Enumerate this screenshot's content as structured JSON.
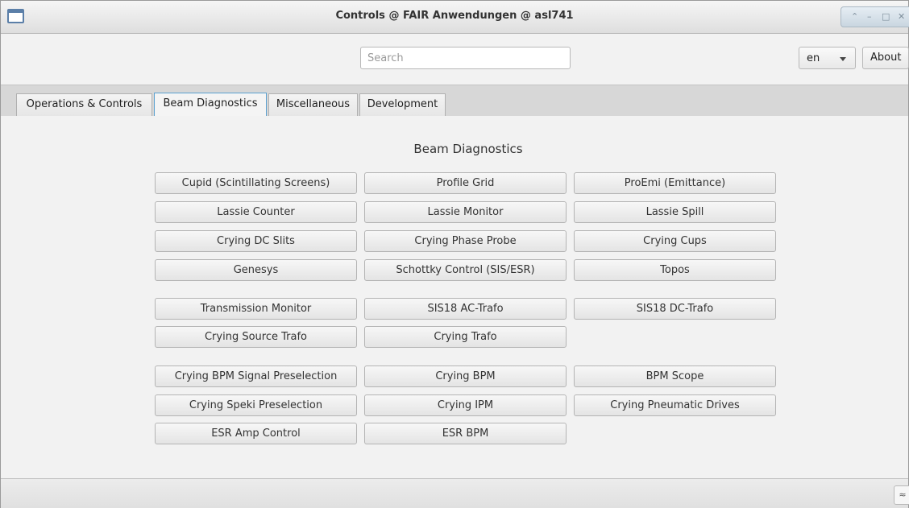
{
  "window": {
    "title": "Controls @ FAIR Anwendungen @ asl741",
    "controls": {
      "up": "⌃",
      "minimize": "–",
      "maximize": "□",
      "close": "✕"
    }
  },
  "toolbar": {
    "search_placeholder": "Search",
    "search_value": "",
    "language": "en",
    "about_label": "About"
  },
  "tabs": [
    {
      "label": "Operations & Controls",
      "active": false
    },
    {
      "label": "Beam Diagnostics",
      "active": true
    },
    {
      "label": "Miscellaneous",
      "active": false
    },
    {
      "label": "Development",
      "active": false
    }
  ],
  "main": {
    "heading": "Beam Diagnostics",
    "buttons": [
      "Cupid (Scintillating Screens)",
      "Profile Grid",
      "ProEmi (Emittance)",
      "Lassie Counter",
      "Lassie Monitor",
      "Lassie Spill",
      "Crying DC Slits",
      "Crying Phase Probe",
      "Crying Cups",
      "Genesys",
      "Schottky Control (SIS/ESR)",
      "Topos",
      "Transmission Monitor",
      "SIS18 AC-Trafo",
      "SIS18 DC-Trafo",
      "Crying Source Trafo",
      "Crying Trafo",
      "Crying BPM Signal Preselection",
      "Crying BPM",
      "BPM Scope",
      "Crying Speki Preselection",
      "Crying IPM",
      "Crying Pneumatic Drives",
      "ESR Amp Control",
      "ESR BPM"
    ]
  },
  "statusbar": {
    "collapse_icon": "≈"
  },
  "colors": {
    "active_tab_border": "#5aa0d0",
    "background": "#f2f2f2"
  }
}
